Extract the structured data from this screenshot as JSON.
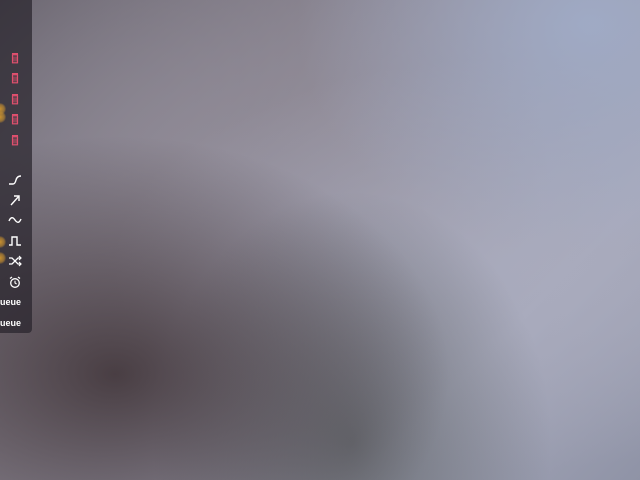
{
  "panel": {
    "accent_color": "#e0506e",
    "icon_color": "#ffffff",
    "trash_items": [
      {
        "icon": "trash-icon"
      },
      {
        "icon": "trash-icon"
      },
      {
        "icon": "trash-icon"
      },
      {
        "icon": "trash-icon"
      },
      {
        "icon": "trash-icon"
      }
    ],
    "curve_tools": [
      {
        "icon": "ease-curve-icon"
      },
      {
        "icon": "ramp-arrow-icon"
      },
      {
        "icon": "sine-wave-icon"
      },
      {
        "icon": "square-wave-icon"
      },
      {
        "icon": "shuffle-icon"
      },
      {
        "icon": "alarm-clock-icon"
      }
    ],
    "queue_labels": [
      "ueue",
      "queue"
    ]
  }
}
